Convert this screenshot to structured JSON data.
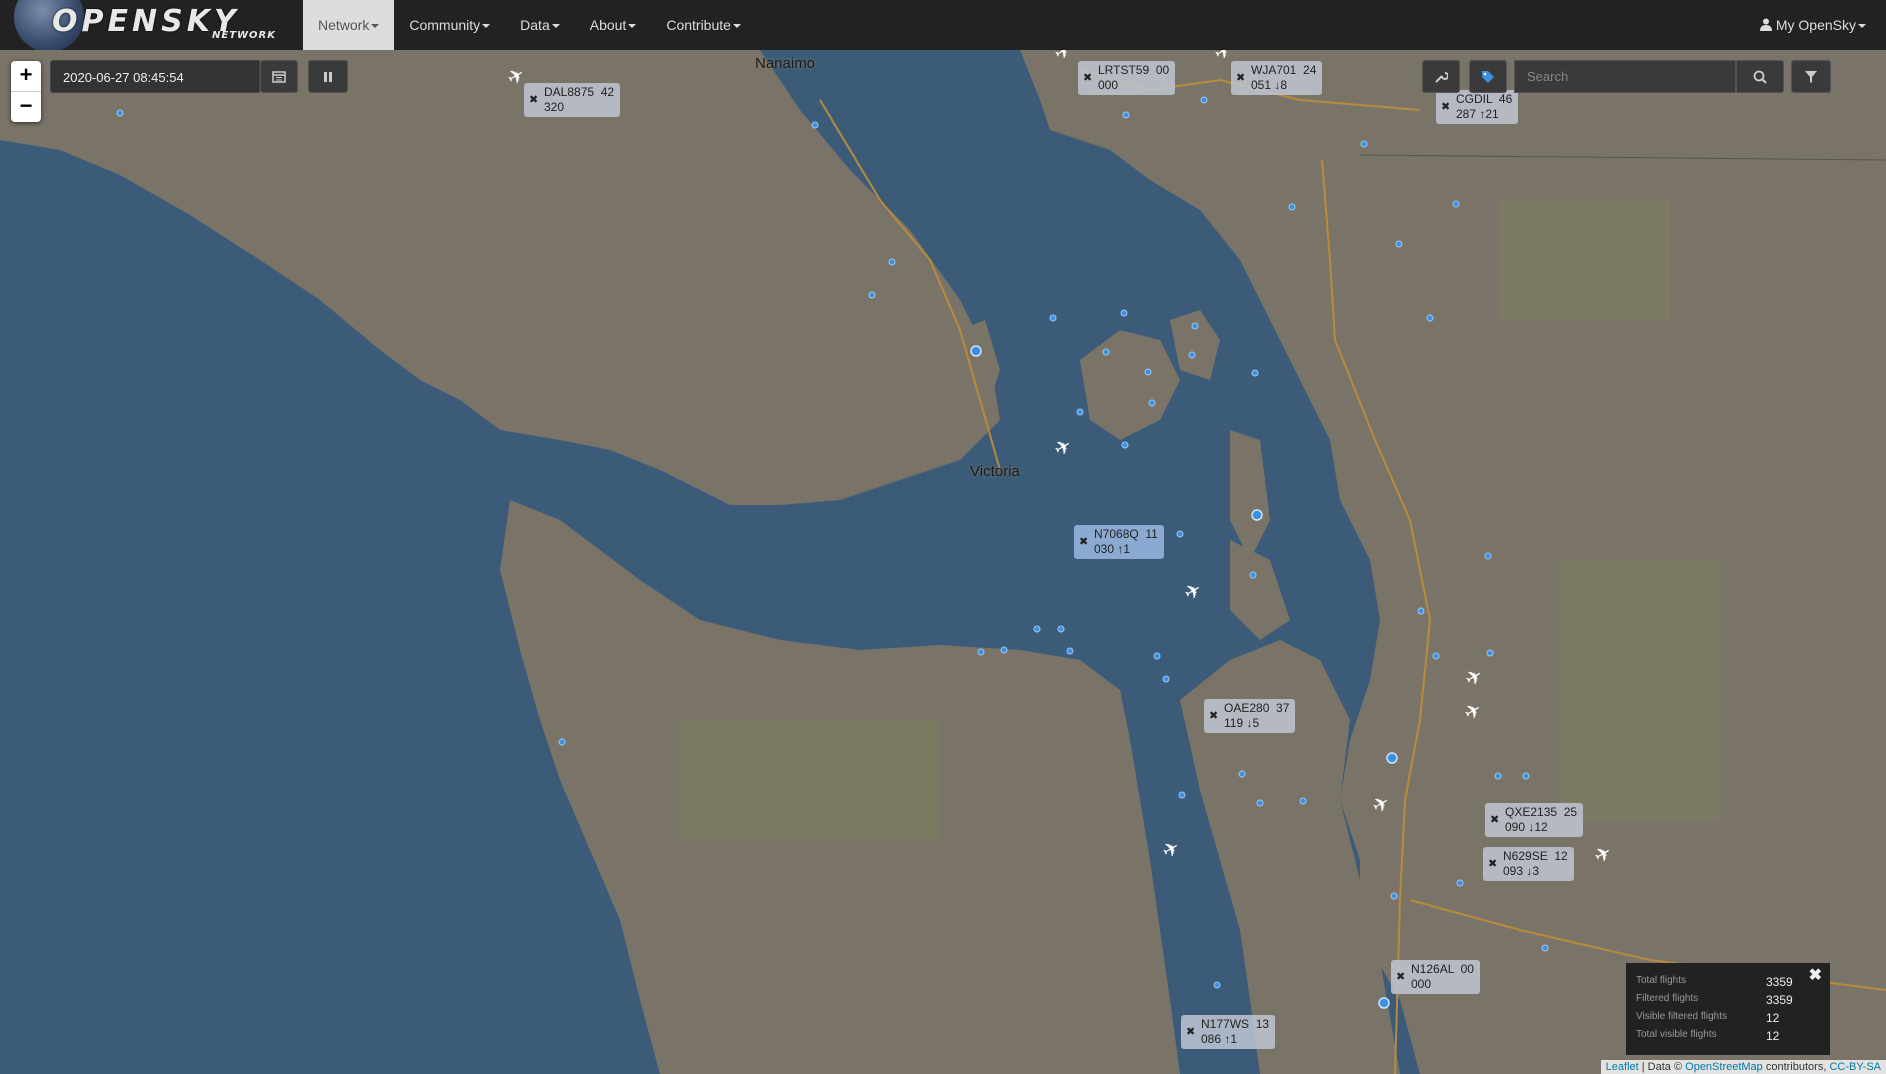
{
  "brand": {
    "logo_text": "OPENSKY",
    "logo_sub": "NETWORK"
  },
  "nav": {
    "items": [
      {
        "label": "Network"
      },
      {
        "label": "Community"
      },
      {
        "label": "Data"
      },
      {
        "label": "About"
      },
      {
        "label": "Contribute"
      }
    ],
    "account": "My OpenSky"
  },
  "controls": {
    "zoom_in": "+",
    "zoom_out": "−",
    "datetime": "2020-06-27 08:45:54",
    "search_placeholder": "Search"
  },
  "map_labels": {
    "nanaimo": "Nanaimo",
    "victoria": "Victoria"
  },
  "flights": [
    {
      "callsign": "DAL8875",
      "alt": "42",
      "line2": "320"
    },
    {
      "callsign": "LRTST59",
      "alt": "00",
      "line2": "000"
    },
    {
      "callsign": "WJA701",
      "alt": "24",
      "line2": "051 ↓8"
    },
    {
      "callsign": "CGDIL",
      "alt": "46",
      "line2": "287 ↑21"
    },
    {
      "callsign": "N7068Q",
      "alt": "11",
      "line2": "030 ↑1"
    },
    {
      "callsign": "OAE280",
      "alt": "37",
      "line2": "119 ↓5"
    },
    {
      "callsign": "QXE2135",
      "alt": "25",
      "line2": "090 ↓12"
    },
    {
      "callsign": "N629SE",
      "alt": "12",
      "line2": "093 ↓3"
    },
    {
      "callsign": "N126AL",
      "alt": "00",
      "line2": "000"
    },
    {
      "callsign": "N177WS",
      "alt": "13",
      "line2": "086 ↑1"
    }
  ],
  "stats": {
    "total_flights_label": "Total flights",
    "total_flights": "3359",
    "filtered_flights_label": "Filtered flights",
    "filtered_flights": "3359",
    "visible_filtered_label": "Visible filtered flights",
    "visible_filtered": "12",
    "total_visible_label": "Total visible flights",
    "total_visible": "12"
  },
  "attribution": {
    "leaflet": "Leaflet",
    "sep": " | Data © ",
    "osm": "OpenStreetMap",
    "contrib": " contributors, ",
    "license": "CC-BY-SA"
  },
  "colors": {
    "navbar": "#222222",
    "water": "#3b5b78",
    "land": "#7a7468",
    "receiver": "#3d8fe0",
    "label_bg": "#bec6d2"
  }
}
